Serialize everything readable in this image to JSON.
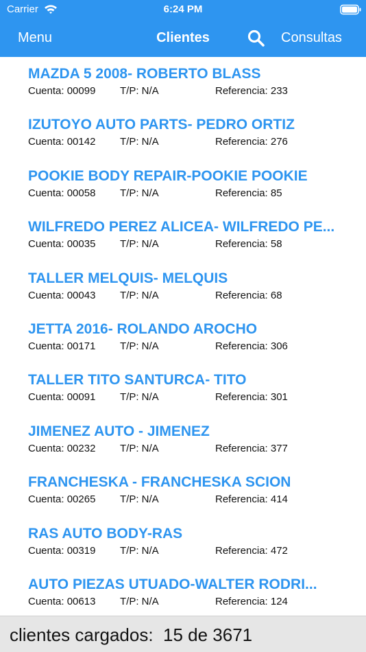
{
  "status_bar": {
    "carrier": "Carrier",
    "time": "6:24 PM",
    "wifi_icon": "wifi-icon",
    "battery_icon": "battery-icon"
  },
  "nav": {
    "menu_label": "Menu",
    "title": "Clientes",
    "search_icon": "search-icon",
    "consultas_label": "Consultas"
  },
  "colors": {
    "accent": "#2e95f0",
    "footer_background": "#e6e6e6"
  },
  "clients": [
    {
      "name": "MAZDA 5 2008- ROBERTO BLASS",
      "cuenta": "Cuenta: 00099",
      "tp": "T/P: N/A",
      "referencia": "Referencia: 233"
    },
    {
      "name": "IZUTOYO AUTO PARTS- PEDRO ORTIZ",
      "cuenta": "Cuenta: 00142",
      "tp": "T/P: N/A",
      "referencia": "Referencia: 276"
    },
    {
      "name": "POOKIE BODY REPAIR-POOKIE POOKIE",
      "cuenta": "Cuenta: 00058",
      "tp": "T/P: N/A",
      "referencia": "Referencia: 85"
    },
    {
      "name": "WILFREDO PEREZ ALICEA- WILFREDO PE...",
      "cuenta": "Cuenta: 00035",
      "tp": "T/P: N/A",
      "referencia": "Referencia: 58"
    },
    {
      "name": "TALLER MELQUIS- MELQUIS",
      "cuenta": "Cuenta: 00043",
      "tp": "T/P: N/A",
      "referencia": "Referencia: 68"
    },
    {
      "name": "JETTA 2016- ROLANDO AROCHO",
      "cuenta": "Cuenta: 00171",
      "tp": "T/P: N/A",
      "referencia": "Referencia: 306"
    },
    {
      "name": "TALLER TITO SANTURCA- TITO",
      "cuenta": "Cuenta: 00091",
      "tp": "T/P: N/A",
      "referencia": "Referencia: 301"
    },
    {
      "name": "JIMENEZ AUTO - JIMENEZ",
      "cuenta": "Cuenta: 00232",
      "tp": "T/P: N/A",
      "referencia": "Referencia: 377"
    },
    {
      "name": "FRANCHESKA - FRANCHESKA SCION",
      "cuenta": "Cuenta: 00265",
      "tp": "T/P: N/A",
      "referencia": "Referencia: 414"
    },
    {
      "name": "RAS AUTO BODY-RAS",
      "cuenta": "Cuenta: 00319",
      "tp": "T/P: N/A",
      "referencia": "Referencia: 472"
    },
    {
      "name": "AUTO PIEZAS UTUADO-WALTER  RODRI...",
      "cuenta": "Cuenta: 00613",
      "tp": "T/P: N/A",
      "referencia": "Referencia: 124"
    }
  ],
  "footer": {
    "label": "clientes cargados:  15 de 3671"
  }
}
